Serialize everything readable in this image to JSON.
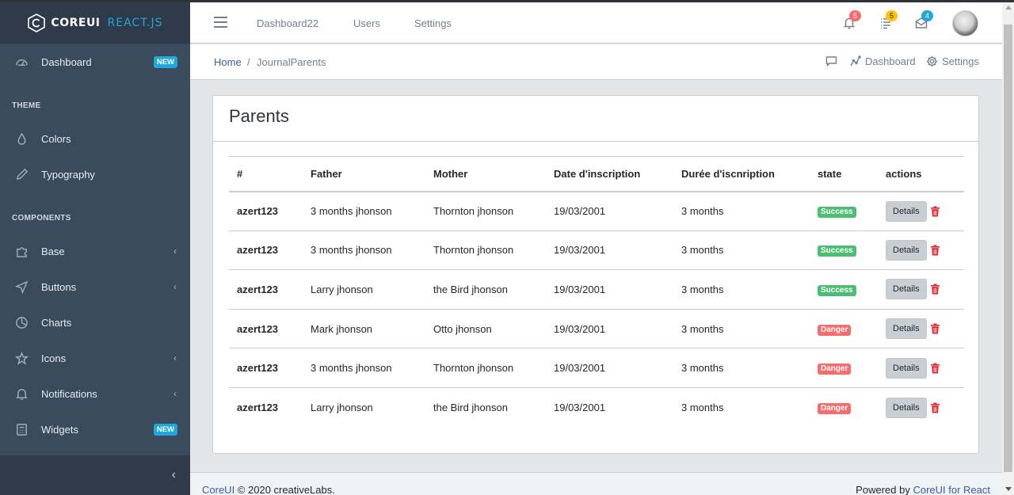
{
  "brand": {
    "name": "COREUI",
    "suffix": "REACT.JS"
  },
  "sidebar": {
    "items": [
      {
        "label": "Dashboard",
        "badge": "NEW",
        "icon": "speedometer-icon"
      },
      {
        "label": "Colors",
        "icon": "drop-icon"
      },
      {
        "label": "Typography",
        "icon": "pencil-icon"
      },
      {
        "label": "Base",
        "icon": "puzzle-icon"
      },
      {
        "label": "Buttons",
        "icon": "cursor-icon"
      },
      {
        "label": "Charts",
        "icon": "chart-pie-icon"
      },
      {
        "label": "Icons",
        "icon": "star-icon"
      },
      {
        "label": "Notifications",
        "icon": "bell-icon"
      },
      {
        "label": "Widgets",
        "badge": "NEW",
        "icon": "calculator-icon"
      }
    ],
    "titles": {
      "theme": "THEME",
      "components": "COMPONENTS"
    },
    "collapse_icon": "‹"
  },
  "header": {
    "nav": [
      "Dashboard22",
      "Users",
      "Settings"
    ],
    "badges": {
      "notifications": "5",
      "tasks": "5",
      "messages": "4"
    },
    "badge_colors": {
      "notifications": "#f86c6b",
      "tasks": "#ffc107",
      "messages": "#20a8d8"
    }
  },
  "breadcrumb": {
    "home": "Home",
    "separator": "/",
    "current": "JournalParents",
    "right": {
      "dashboard": "Dashboard",
      "settings": "Settings"
    }
  },
  "card": {
    "title": "Parents",
    "columns": [
      "#",
      "Father",
      "Mother",
      "Date d'inscription",
      "Durée d'iscnription",
      "state",
      "actions"
    ],
    "details_label": "Details",
    "rows": [
      {
        "id": "azert123",
        "father": "3 months jhonson",
        "mother": "Thornton jhonson",
        "date": "19/03/2001",
        "duree": "3 months",
        "state": "Success"
      },
      {
        "id": "azert123",
        "father": "3 months jhonson",
        "mother": "Thornton jhonson",
        "date": "19/03/2001",
        "duree": "3 months",
        "state": "Success"
      },
      {
        "id": "azert123",
        "father": "Larry jhonson",
        "mother": "the Bird jhonson",
        "date": "19/03/2001",
        "duree": "3 months",
        "state": "Success"
      },
      {
        "id": "azert123",
        "father": "Mark jhonson",
        "mother": "Otto jhonson",
        "date": "19/03/2001",
        "duree": "3 months",
        "state": "Danger"
      },
      {
        "id": "azert123",
        "father": "3 months jhonson",
        "mother": "Thornton jhonson",
        "date": "19/03/2001",
        "duree": "3 months",
        "state": "Danger"
      },
      {
        "id": "azert123",
        "father": "Larry jhonson",
        "mother": "the Bird jhonson",
        "date": "19/03/2001",
        "duree": "3 months",
        "state": "Danger"
      }
    ],
    "state_colors": {
      "Success": "#4dbd74",
      "Danger": "#f86c6b"
    }
  },
  "footer": {
    "left_link": "CoreUI",
    "left_text": "© 2020 creativeLabs.",
    "right_text": "Powered by",
    "right_link": "CoreUI for React"
  }
}
